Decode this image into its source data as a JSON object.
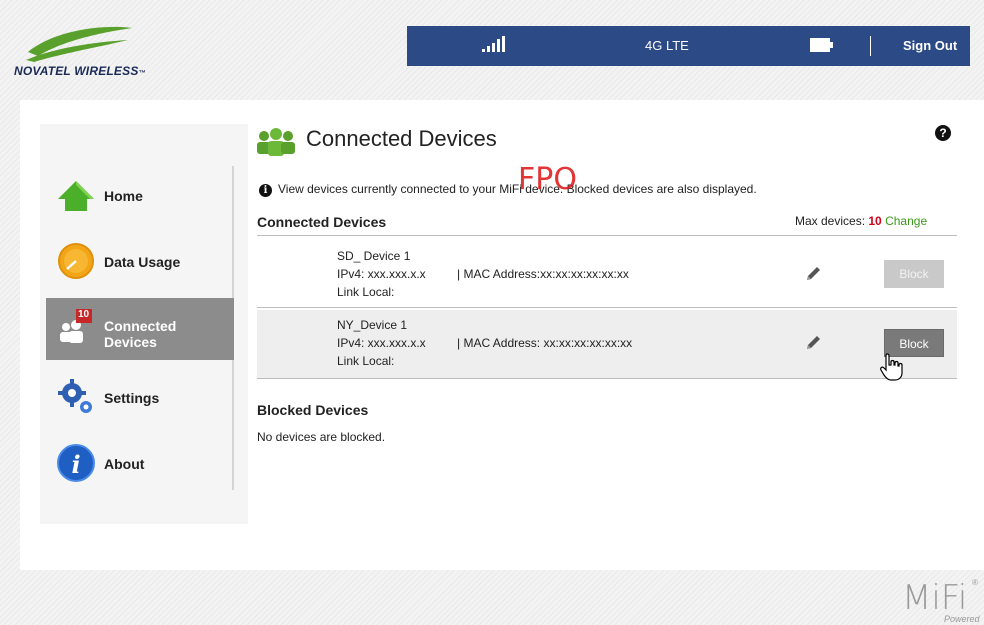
{
  "brand": {
    "logo_text": "NOVATEL WIRELESS",
    "logo_tm": "™",
    "accent": "#2c4a86",
    "logo_green": "#5aa02c"
  },
  "topbar": {
    "signal_icon": "signal-bars-icon",
    "network": "4G LTE",
    "battery_icon": "battery-icon",
    "sign_out": "Sign Out"
  },
  "sidebar": {
    "items": [
      {
        "label": "Home",
        "icon": "home-icon",
        "active": false
      },
      {
        "label": "Data Usage",
        "icon": "data-usage-icon",
        "active": false
      },
      {
        "label_line1": "Connected",
        "label_line2": "Devices",
        "icon": "connected-devices-icon",
        "badge": "10",
        "active": true
      },
      {
        "label": "Settings",
        "icon": "settings-icon",
        "active": false
      },
      {
        "label": "About",
        "icon": "about-icon",
        "active": false
      }
    ]
  },
  "page": {
    "title": "Connected Devices",
    "help_glyph": "?",
    "info_glyph": "i",
    "info_text": "View devices currently connected to your MiFi device. Blocked devices are also displayed.",
    "watermark": "FPO"
  },
  "connected": {
    "heading": "Connected Devices",
    "max_label": "Max devices:",
    "max_count": "10",
    "change_label": "Change",
    "devices": [
      {
        "name": "SD_ Device 1",
        "ip": "IPv4: xxx.xxx.x.x",
        "mac": "| MAC Address:xx:xx:xx:xx:xx:xx",
        "link": "Link Local:",
        "block_label": "Block",
        "block_enabled": false
      },
      {
        "name": "NY_Device 1",
        "ip": "IPv4: xxx.xxx.x.x",
        "mac": "| MAC Address: xx:xx:xx:xx:xx:xx",
        "link": "Link Local:",
        "block_label": "Block",
        "block_enabled": true
      }
    ]
  },
  "blocked": {
    "heading": "Blocked Devices",
    "empty_text": "No devices are blocked."
  },
  "footer": {
    "mifi": "MiFi",
    "reg": "®",
    "powered": "Powered"
  }
}
